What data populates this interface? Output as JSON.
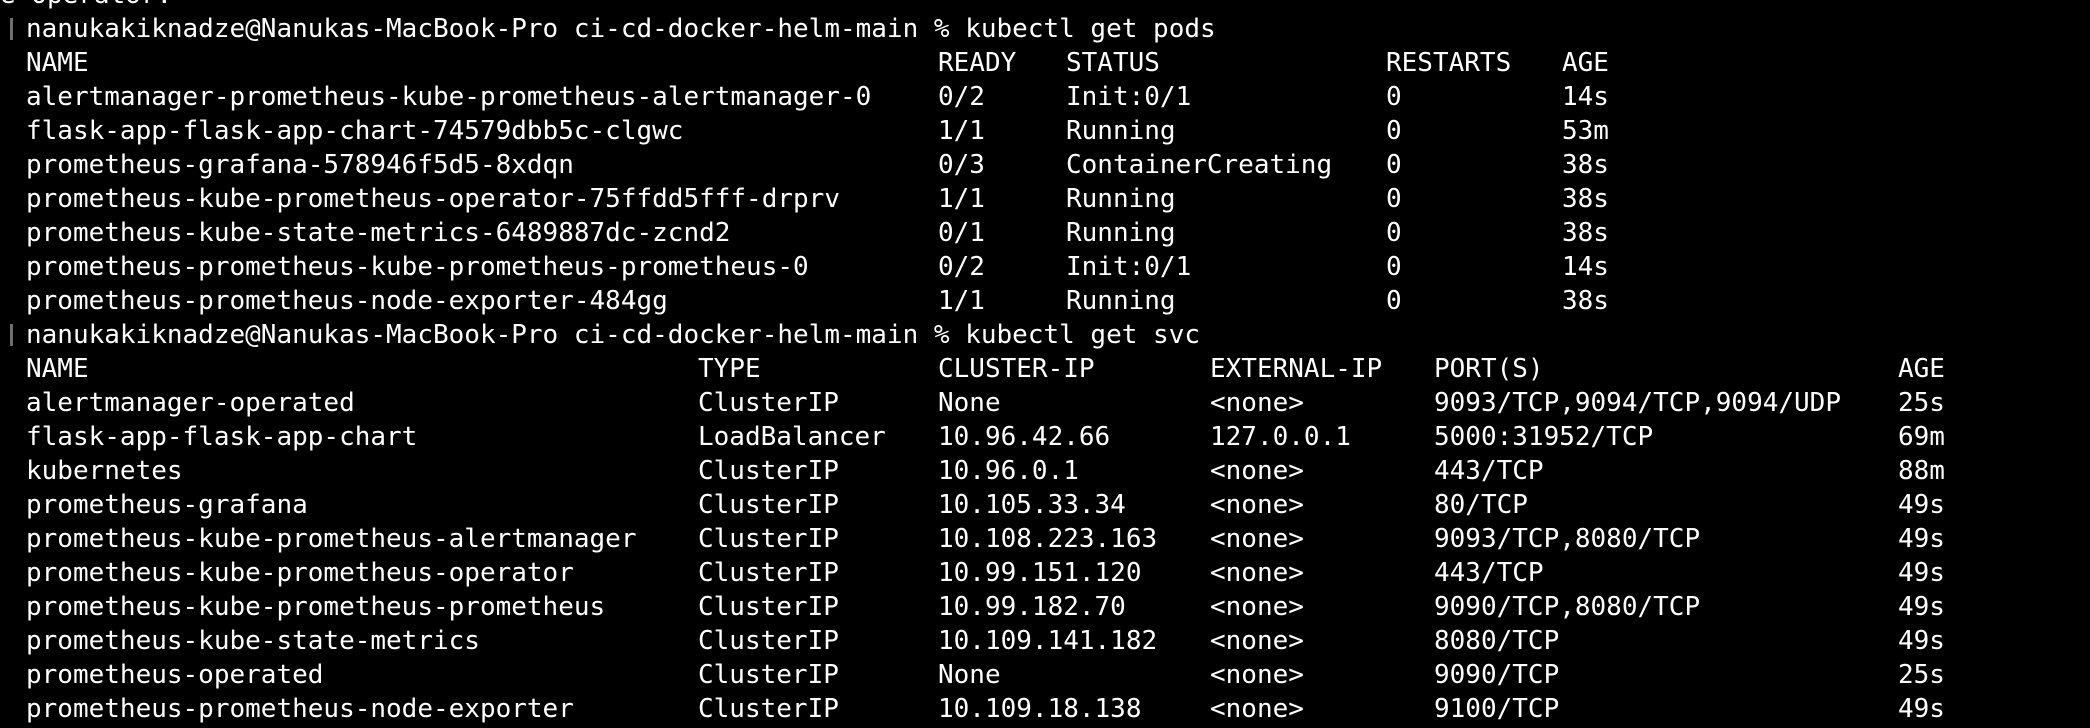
{
  "terminal": {
    "previous_line": "e Operator.",
    "prompt": "nanukakiknadze@Nanukas-MacBook-Pro ci-cd-docker-helm-main %",
    "commands": {
      "pods": "kubectl get pods",
      "svc": "kubectl get svc"
    },
    "pods_table": {
      "headers": [
        "NAME",
        "READY",
        "STATUS",
        "RESTARTS",
        "AGE"
      ],
      "rows": [
        [
          "alertmanager-prometheus-kube-prometheus-alertmanager-0",
          "0/2",
          "Init:0/1",
          "0",
          "14s"
        ],
        [
          "flask-app-flask-app-chart-74579dbb5c-clgwc",
          "1/1",
          "Running",
          "0",
          "53m"
        ],
        [
          "prometheus-grafana-578946f5d5-8xdqn",
          "0/3",
          "ContainerCreating",
          "0",
          "38s"
        ],
        [
          "prometheus-kube-prometheus-operator-75ffdd5fff-drprv",
          "1/1",
          "Running",
          "0",
          "38s"
        ],
        [
          "prometheus-kube-state-metrics-6489887dc-zcnd2",
          "0/1",
          "Running",
          "0",
          "38s"
        ],
        [
          "prometheus-prometheus-kube-prometheus-prometheus-0",
          "0/2",
          "Init:0/1",
          "0",
          "14s"
        ],
        [
          "prometheus-prometheus-node-exporter-484gg",
          "1/1",
          "Running",
          "0",
          "38s"
        ]
      ]
    },
    "svc_table": {
      "headers": [
        "NAME",
        "TYPE",
        "CLUSTER-IP",
        "EXTERNAL-IP",
        "PORT(S)",
        "AGE"
      ],
      "rows": [
        [
          "alertmanager-operated",
          "ClusterIP",
          "None",
          "<none>",
          "9093/TCP,9094/TCP,9094/UDP",
          "25s"
        ],
        [
          "flask-app-flask-app-chart",
          "LoadBalancer",
          "10.96.42.66",
          "127.0.0.1",
          "5000:31952/TCP",
          "69m"
        ],
        [
          "kubernetes",
          "ClusterIP",
          "10.96.0.1",
          "<none>",
          "443/TCP",
          "88m"
        ],
        [
          "prometheus-grafana",
          "ClusterIP",
          "10.105.33.34",
          "<none>",
          "80/TCP",
          "49s"
        ],
        [
          "prometheus-kube-prometheus-alertmanager",
          "ClusterIP",
          "10.108.223.163",
          "<none>",
          "9093/TCP,8080/TCP",
          "49s"
        ],
        [
          "prometheus-kube-prometheus-operator",
          "ClusterIP",
          "10.99.151.120",
          "<none>",
          "443/TCP",
          "49s"
        ],
        [
          "prometheus-kube-prometheus-prometheus",
          "ClusterIP",
          "10.99.182.70",
          "<none>",
          "9090/TCP,8080/TCP",
          "49s"
        ],
        [
          "prometheus-kube-state-metrics",
          "ClusterIP",
          "10.109.141.182",
          "<none>",
          "8080/TCP",
          "49s"
        ],
        [
          "prometheus-operated",
          "ClusterIP",
          "None",
          "<none>",
          "9090/TCP",
          "25s"
        ],
        [
          "prometheus-prometheus-node-exporter",
          "ClusterIP",
          "10.109.18.138",
          "<none>",
          "9100/TCP",
          "49s"
        ]
      ]
    },
    "colors": {
      "background": "#000000",
      "text": "#ffffff",
      "prompt_marker": "#6e6e6e"
    }
  }
}
